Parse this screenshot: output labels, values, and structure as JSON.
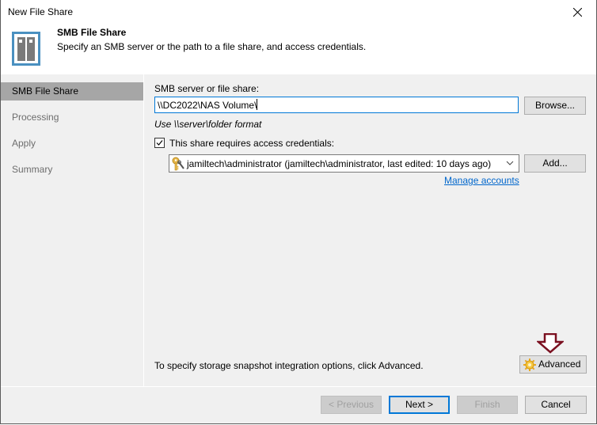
{
  "window": {
    "title": "New File Share",
    "close_icon": "close-x-icon"
  },
  "header": {
    "icon": "file-share-icon",
    "title": "SMB File Share",
    "subtitle": "Specify an SMB server or the path to a file share, and access credentials."
  },
  "sidebar": {
    "items": [
      {
        "label": "SMB File Share",
        "active": true
      },
      {
        "label": "Processing",
        "active": false
      },
      {
        "label": "Apply",
        "active": false
      },
      {
        "label": "Summary",
        "active": false
      }
    ]
  },
  "content": {
    "share_label": "SMB server or file share:",
    "share_value": "\\\\DC2022\\NAS Volume\\",
    "browse_label": "Browse...",
    "format_hint": "Use \\\\server\\folder format",
    "credentials_checkbox_label": "This share requires access credentials:",
    "credentials_checked": true,
    "credentials_selected": "jamiltech\\administrator (jamiltech\\administrator, last edited: 10 days ago)",
    "credentials_icon": "key-icon",
    "add_label": "Add...",
    "manage_accounts_label": "Manage accounts",
    "advanced_hint": "To specify storage snapshot integration options, click Advanced.",
    "advanced_label": "Advanced",
    "advanced_icon": "gear-icon",
    "annotation_icon": "arrow-down-icon",
    "annotation_color": "#7b1020"
  },
  "footer": {
    "previous_label": "< Previous",
    "next_label": "Next >",
    "finish_label": "Finish",
    "cancel_label": "Cancel"
  },
  "colors": {
    "accent": "#0078d7",
    "link": "#0066cc",
    "sidebar_active": "#a6a6a6",
    "panel_bg": "#f0f0f0"
  }
}
